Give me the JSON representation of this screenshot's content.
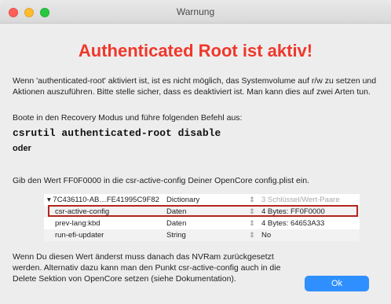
{
  "window": {
    "title": "Warnung"
  },
  "headline": "Authenticated Root ist aktiv!",
  "paragraphs": {
    "p1": "Wenn 'authenticated-root' aktiviert ist, ist es nicht möglich, das Systemvolume auf r/w zu setzen und Aktionen auszuführen. Bitte stelle sicher, dass es deaktiviert ist. Man kann dies auf zwei Arten tun.",
    "p2": "Boote in den Recovery Modus und führe folgenden Befehl aus:",
    "command": "csrutil authenticated-root disable",
    "oder": "oder",
    "p3": "Gib den Wert FF0F0000 in die csr-active-config Deiner OpenCore config.plist ein.",
    "p4": "Wenn Du diesen Wert änderst muss danach das NVRam zurückgesetzt werden. Alternativ dazu kann man den Punkt csr-active-config auch in die Delete Sektion von OpenCore setzen (siehe Dokumentation)."
  },
  "plist": {
    "rows": [
      {
        "key": "▾ 7C436110-AB…FE41995C9F82",
        "type": "Dictionary",
        "stepper": "⇕",
        "value": "3 Schlüssel/Wert-Paare",
        "dim": true
      },
      {
        "key": "csr-active-config",
        "type": "Daten",
        "stepper": "⇕",
        "value": "4 Bytes: FF0F0000",
        "dim": false
      },
      {
        "key": "prev-lang:kbd",
        "type": "Daten",
        "stepper": "⇕",
        "value": "4 Bytes: 64653A33",
        "dim": false
      },
      {
        "key": "run-efi-updater",
        "type": "String",
        "stepper": "⇕",
        "value": "No",
        "dim": false
      }
    ]
  },
  "buttons": {
    "ok": "Ok"
  },
  "colors": {
    "headline": "#f0372b",
    "highlight_border": "#b3261e",
    "ok_button": "#2f8fff"
  }
}
